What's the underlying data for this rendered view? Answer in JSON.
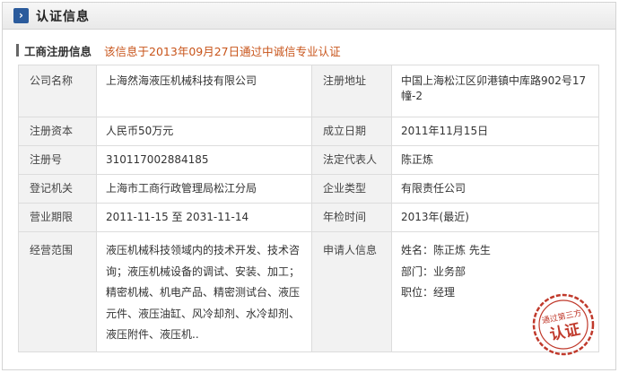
{
  "header": {
    "title": "认证信息",
    "icon": "chevron-right-icon"
  },
  "section": {
    "title": "工商注册信息",
    "note": "该信息于2013年09月27日通过中诚信专业认证",
    "note_color": "#c8541a"
  },
  "table": {
    "company_name_label": "公司名称",
    "company_name": "上海然海液压机械科技有限公司",
    "reg_address_label": "注册地址",
    "reg_address": "中国上海松江区卯港镇中库路902号17幢-2",
    "capital_label": "注册资本",
    "capital": "人民币50万元",
    "founded_label": "成立日期",
    "founded": "2011年11月15日",
    "reg_no_label": "注册号",
    "reg_no": "310117002884185",
    "legal_rep_label": "法定代表人",
    "legal_rep": "陈正炼",
    "authority_label": "登记机关",
    "authority": "上海市工商行政管理局松江分局",
    "company_type_label": "企业类型",
    "company_type": "有限责任公司",
    "term_label": "营业期限",
    "term": "2011-11-15 至 2031-11-14",
    "inspection_label": "年检时间",
    "inspection": "2013年(最近)",
    "scope_label": "经营范围",
    "scope": "液压机械科技领域内的技术开发、技术咨询；液压机械设备的调试、安装、加工；精密机械、机电产品、精密测试台、液压元件、液压油缸、风冷却剂、水冷却剂、液压附件、液压机..",
    "applicant_label": "申请人信息",
    "applicant_name": "姓名：陈正炼 先生",
    "applicant_dept": "部门：业务部",
    "applicant_title": "职位：经理"
  },
  "stamp": {
    "top_text": "通过第三方",
    "main_text": "认证",
    "color": "#c0392b"
  }
}
